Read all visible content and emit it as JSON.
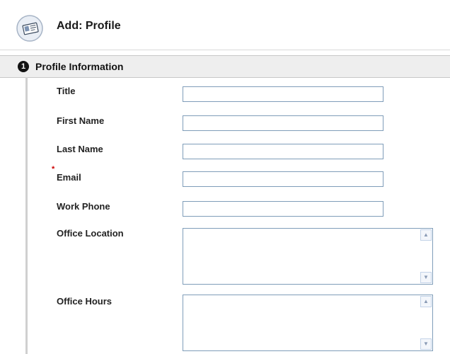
{
  "header": {
    "title": "Add: Profile",
    "icon": "profile-card-icon"
  },
  "section": {
    "step_number": "1",
    "title": "Profile Information"
  },
  "fields": {
    "title": {
      "label": "Title",
      "value": ""
    },
    "first_name": {
      "label": "First Name",
      "value": ""
    },
    "last_name": {
      "label": "Last Name",
      "value": ""
    },
    "email": {
      "label": "Email",
      "value": "",
      "required_marker": "*"
    },
    "work_phone": {
      "label": "Work Phone",
      "value": ""
    },
    "office_location": {
      "label": "Office Location",
      "value": ""
    },
    "office_hours": {
      "label": "Office Hours",
      "value": ""
    }
  },
  "colors": {
    "required": "#cc0000",
    "input_border": "#7f9db9",
    "section_bg": "#eeeeee"
  }
}
